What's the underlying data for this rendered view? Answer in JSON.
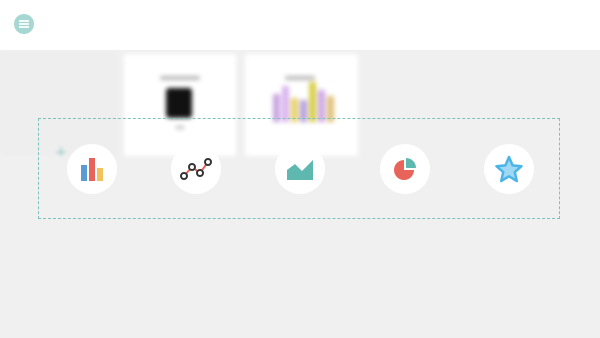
{
  "header": {
    "menu_icon": "hamburger-menu-icon",
    "accent_color": "#5fb8b0"
  },
  "background_cards": {
    "add_card_icon": "plus-icon",
    "card_1_icon": "phone-preview-icon",
    "card_2_icon": "bar-chart-preview-icon"
  },
  "chart_types": [
    {
      "icon": "bar-chart-icon",
      "colors": [
        "#5b9bd5",
        "#e8645a",
        "#f2c25c"
      ]
    },
    {
      "icon": "line-chart-icon",
      "colors": [
        "#333333",
        "#e8645a"
      ]
    },
    {
      "icon": "area-chart-icon",
      "colors": [
        "#5fb8b0"
      ]
    },
    {
      "icon": "pie-chart-icon",
      "colors": [
        "#e8645a",
        "#5fb8b0"
      ]
    },
    {
      "icon": "star-icon",
      "colors": [
        "#4db4e8"
      ]
    }
  ],
  "selection_border_color": "#7cc2bb"
}
